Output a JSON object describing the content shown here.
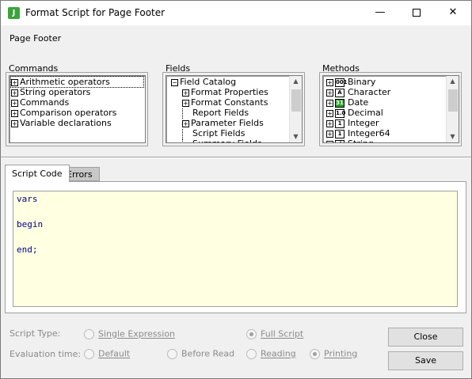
{
  "window": {
    "title": "Format Script for Page Footer",
    "app_icon_letter": "J",
    "minimize_symbol": "—",
    "close_symbol": "✕"
  },
  "context_label": "Page Footer",
  "commands": {
    "label": "Commands",
    "items": [
      {
        "expander": "+",
        "label": "Arithmetic operators"
      },
      {
        "expander": "+",
        "label": "String operators"
      },
      {
        "expander": "+",
        "label": "Commands"
      },
      {
        "expander": "+",
        "label": "Comparison operators"
      },
      {
        "expander": "+",
        "label": "Variable declarations"
      }
    ]
  },
  "fields": {
    "label": "Fields",
    "root": {
      "expander": "−",
      "label": "Field Catalog"
    },
    "items": [
      {
        "expander": "+",
        "label": "Format Properties"
      },
      {
        "expander": "+",
        "label": "Format Constants"
      },
      {
        "expander": "",
        "label": "Report Fields"
      },
      {
        "expander": "+",
        "label": "Parameter Fields"
      },
      {
        "expander": "",
        "label": "Script Fields"
      },
      {
        "expander": "",
        "label": "Summary Fields"
      }
    ]
  },
  "methods": {
    "label": "Methods",
    "items": [
      {
        "expander": "+",
        "icon": "binary-icon",
        "icon_text": "001",
        "label": "Binary"
      },
      {
        "expander": "+",
        "icon": "character-icon",
        "icon_text": "A",
        "label": "Character"
      },
      {
        "expander": "+",
        "icon": "date-icon",
        "icon_text": "31",
        "label": "Date"
      },
      {
        "expander": "+",
        "icon": "decimal-icon",
        "icon_text": "1.0",
        "label": "Decimal"
      },
      {
        "expander": "+",
        "icon": "integer-icon",
        "icon_text": "1",
        "label": "Integer"
      },
      {
        "expander": "+",
        "icon": "integer64-icon",
        "icon_text": "1",
        "label": "Integer64"
      },
      {
        "expander": "+",
        "icon": "string-icon",
        "icon_text": "ab",
        "label": "String"
      }
    ]
  },
  "tabs": [
    {
      "label": "Script Code",
      "active": true
    },
    {
      "label": "Errors",
      "active": false
    }
  ],
  "script_code": [
    "vars",
    "",
    "begin",
    "",
    "end;"
  ],
  "script_type": {
    "label": "Script Type:",
    "options": [
      {
        "label": "Single Expression",
        "selected": false
      },
      {
        "label": "Full Script",
        "selected": true
      }
    ]
  },
  "evaluation_time": {
    "label": "Evaluation time:",
    "options": [
      {
        "label": "Default",
        "selected": false
      },
      {
        "label": "Before Read",
        "selected": false
      },
      {
        "label": "Reading",
        "selected": false
      },
      {
        "label": "Printing",
        "selected": true
      }
    ]
  },
  "buttons": {
    "close": "Close",
    "save": "Save"
  },
  "colors": {
    "editor_background": "#ffffe1",
    "code_text": "#00008b",
    "app_icon": "#3aa53a"
  }
}
